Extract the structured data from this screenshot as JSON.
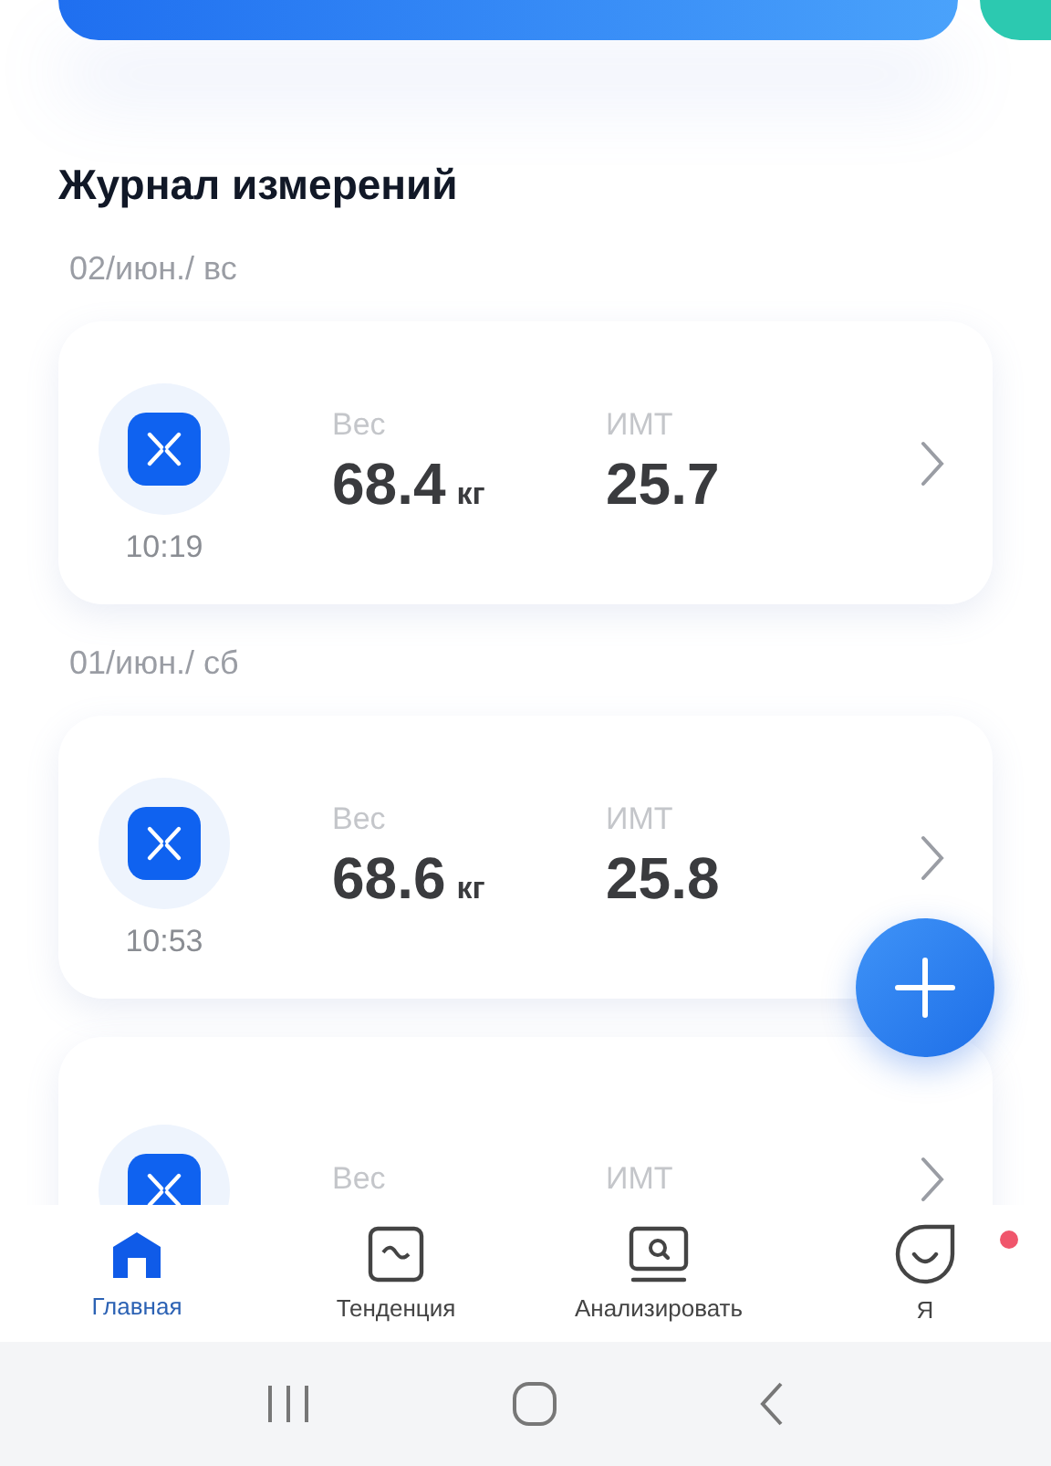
{
  "section_title": "Журнал измерений",
  "days": [
    {
      "date": "02/июн./ вс",
      "entries": [
        {
          "time": "10:19",
          "weight_label": "Вес",
          "weight": "68.4",
          "weight_unit": "кг",
          "bmi_label": "ИМТ",
          "bmi": "25.7"
        }
      ]
    },
    {
      "date": "01/июн./ сб",
      "entries": [
        {
          "time": "10:53",
          "weight_label": "Вес",
          "weight": "68.6",
          "weight_unit": "кг",
          "bmi_label": "ИМТ",
          "bmi": "25.8"
        }
      ]
    },
    {
      "entries": [
        {
          "weight_label": "Вес",
          "bmi_label": "ИМТ"
        }
      ]
    }
  ],
  "tabs": [
    {
      "kind": "home",
      "label": "Главная",
      "selected": true,
      "badge": false
    },
    {
      "kind": "trend",
      "label": "Тенденция",
      "selected": false,
      "badge": false
    },
    {
      "kind": "analyze",
      "label": "Анализировать",
      "selected": false,
      "badge": false
    },
    {
      "kind": "me",
      "label": "Я",
      "selected": false,
      "badge": true
    }
  ]
}
